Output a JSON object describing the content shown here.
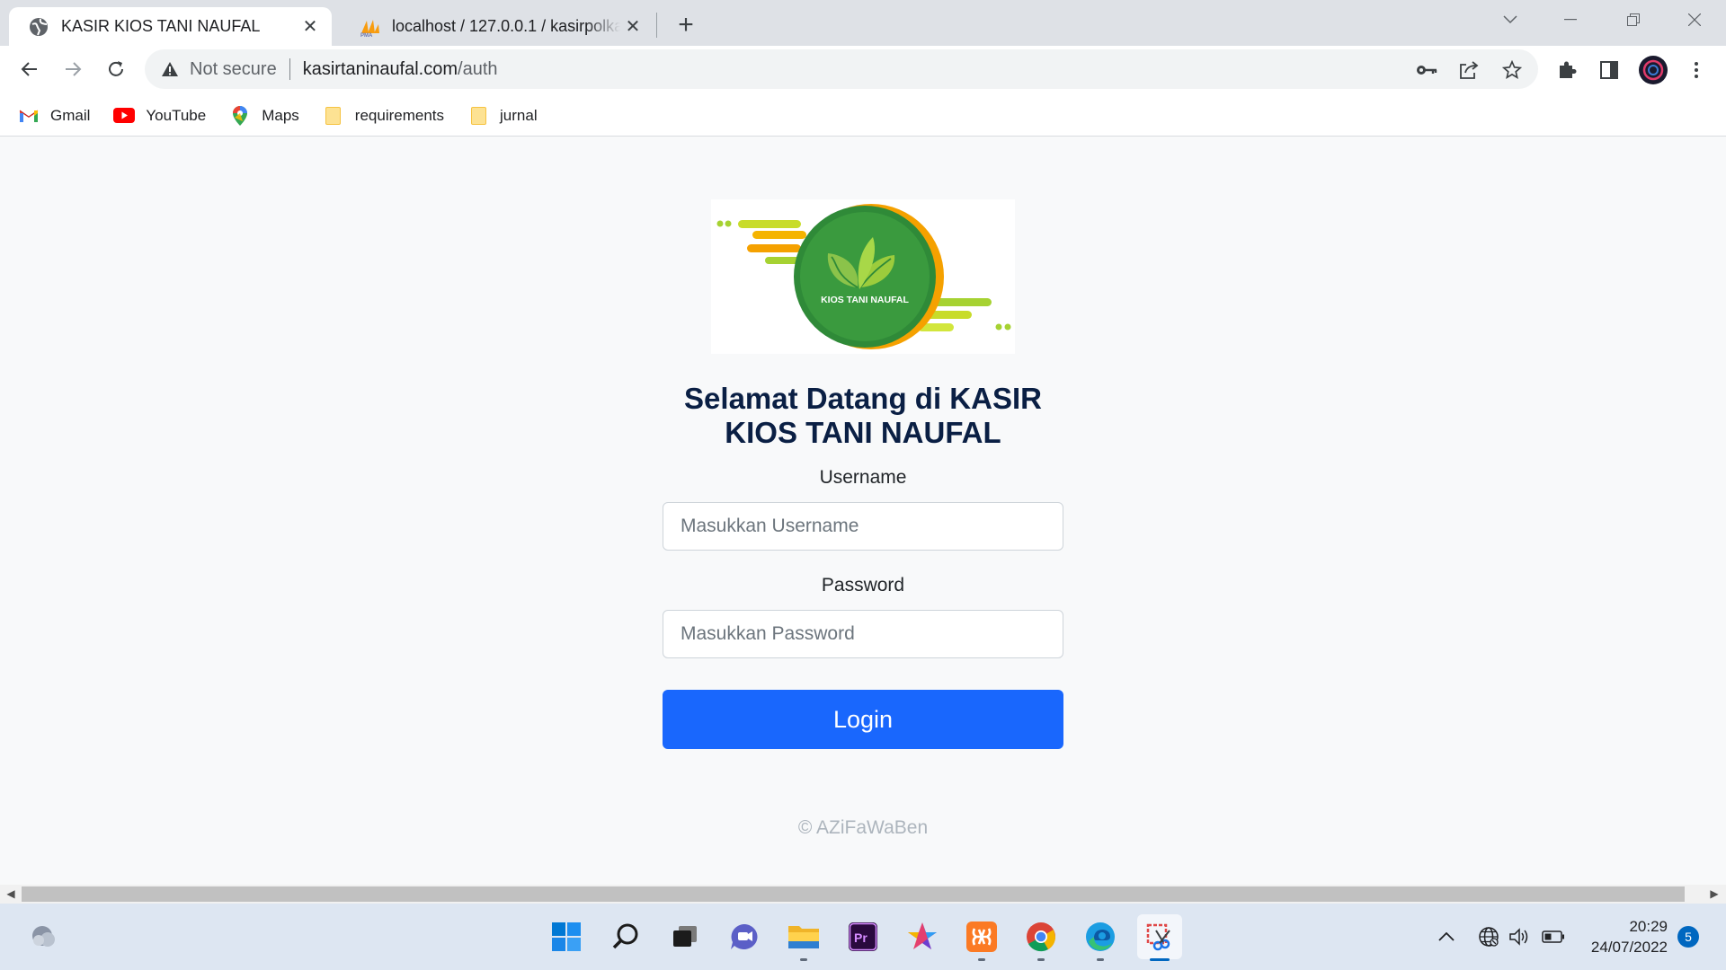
{
  "browser": {
    "tabs": [
      {
        "title": "KASIR KIOS TANI NAUFAL",
        "active": true,
        "icon": "globe-icon"
      },
      {
        "title": "localhost / 127.0.0.1 / kasirpolkam",
        "active": false,
        "icon": "phpmyadmin-icon"
      }
    ],
    "new_tab_label": "+",
    "address": {
      "security_text": "Not secure",
      "host": "kasirtaninaufal.com",
      "path": "/auth"
    },
    "bookmarks": [
      {
        "label": "Gmail",
        "icon": "gmail-icon"
      },
      {
        "label": "YouTube",
        "icon": "youtube-icon"
      },
      {
        "label": "Maps",
        "icon": "maps-icon"
      },
      {
        "label": "requirements",
        "icon": "folder-icon"
      },
      {
        "label": "jurnal",
        "icon": "folder-icon"
      }
    ]
  },
  "page": {
    "logo_text": "KIOS TANI NAUFAL",
    "welcome_line1": "Selamat Datang di KASIR",
    "welcome_line2": "KIOS TANI NAUFAL",
    "username_label": "Username",
    "username_placeholder": "Masukkan Username",
    "password_label": "Password",
    "password_placeholder": "Masukkan Password",
    "login_button": "Login",
    "copyright": "© AZiFaWaBen",
    "colors": {
      "primary_button": "#1967fd",
      "heading": "#0a1f44",
      "logo_green": "#2e8b3a",
      "logo_orange": "#f5a100"
    }
  },
  "taskbar": {
    "apps": [
      "windows-start-icon",
      "search-icon",
      "task-view-icon",
      "teams-chat-icon",
      "file-explorer-icon",
      "premiere-pro-icon",
      "star-app-icon",
      "xampp-icon",
      "chrome-icon",
      "edge-icon",
      "snipping-tool-icon"
    ],
    "time": "20:29",
    "date": "24/07/2022",
    "notifications": "5"
  }
}
